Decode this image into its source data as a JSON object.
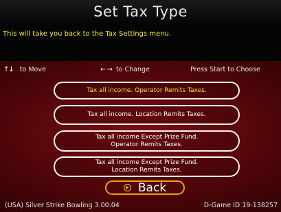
{
  "title": "Set Tax Type",
  "description": "This will take you back to the Tax Settings menu.",
  "controls": {
    "move_arrows": "↑↓",
    "move_label": "to Move",
    "change_arrows": "← →",
    "change_label": "to Change",
    "start_label": "Press Start to Choose"
  },
  "menu": {
    "items": [
      {
        "label": "Tax all income. Operator Remits Taxes.",
        "selected": true
      },
      {
        "label": "Tax all income. Location Remits Taxes.",
        "selected": false
      },
      {
        "label": "Tax all income Except Prize Fund. Operator Remits Taxes.",
        "selected": false
      },
      {
        "label": "Tax all income Except Prize Fund. Location Remits Taxes.",
        "selected": false
      }
    ]
  },
  "back": {
    "label": "Back",
    "icon": "chevron-right-icon"
  },
  "footer": {
    "game_info": "(USA) Silver Strike Bowling 3.00.04",
    "device_id": "D-Game ID 19-138257"
  },
  "colors": {
    "highlight": "#f0e63c",
    "back_border": "#e8a41a",
    "background": "#4a0508"
  }
}
